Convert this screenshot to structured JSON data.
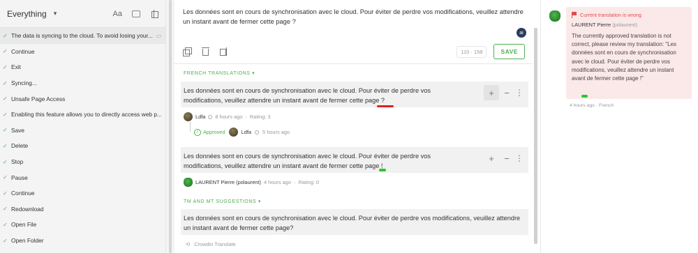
{
  "filter": {
    "selected": "Everything",
    "tool_case": "Aa"
  },
  "strings": [
    {
      "text": "The data is syncing to the cloud. To avoid losing your...",
      "active": true
    },
    {
      "text": "Continue"
    },
    {
      "text": "Exit"
    },
    {
      "text": "Syncing..."
    },
    {
      "text": "Unsafe Page Access"
    },
    {
      "text": "Enabling this feature allows you to directly access web p..."
    },
    {
      "text": "Save"
    },
    {
      "text": "Delete"
    },
    {
      "text": "Stop"
    },
    {
      "text": "Pause"
    },
    {
      "text": "Continue"
    },
    {
      "text": "Redownload"
    },
    {
      "text": "Open File"
    },
    {
      "text": "Open Folder"
    }
  ],
  "editor": {
    "source_text": "Les données sont en cours de synchronisation avec le cloud. Pour éviter de perdre vos modifications, veuillez attendre un instant avant de fermer cette page ?",
    "counter": "110 · 158",
    "save_label": "SAVE",
    "ai_label": "ai"
  },
  "french_translations": {
    "header": "FRENCH TRANSLATIONS",
    "items": [
      {
        "text": "Les données sont en cours de synchronisation avec le cloud. Pour éviter de perdre vos modifications, veuillez attendre un instant avant de fermer cette page ?",
        "author": "Ldfa",
        "time": "8 hours ago",
        "rating": "Rating: 3",
        "approved_label": "Approved",
        "approver": "Ldfa",
        "approved_time": "5 hours ago"
      },
      {
        "text": "Les données sont en cours de synchronisation avec le cloud. Pour éviter de perdre vos modifications, veuillez attendre un instant avant de fermer cette page !",
        "author": "LAURENT Pierre (polaurent)",
        "time": "4 hours ago",
        "rating": "Rating: 0"
      }
    ]
  },
  "tm_mt": {
    "header": "TM AND MT SUGGESTIONS",
    "text": "Les données sont en cours de synchronisation avec le cloud. Pour éviter de perdre vos modifications, veuillez attendre un instant avant de fermer cette page?",
    "source": "Crowdin Translate"
  },
  "comment": {
    "flag_label": "Current translation is wrong",
    "author": "LAURENT Pierre",
    "handle": "(polaurent)",
    "body": "The currently approved translation is not correct, please review my translation: \"Les données sont en cours de synchronisation avec le cloud. Pour éviter de perdre vos modifications, veuillez attendre un instant avant de fermer cette page !\"",
    "footer": "4 hours ago · French"
  },
  "colors": {
    "accent": "#4caf50",
    "issue_red": "#e04b4b",
    "highlight_red": "#e02020",
    "highlight_green": "#2ec52e"
  }
}
